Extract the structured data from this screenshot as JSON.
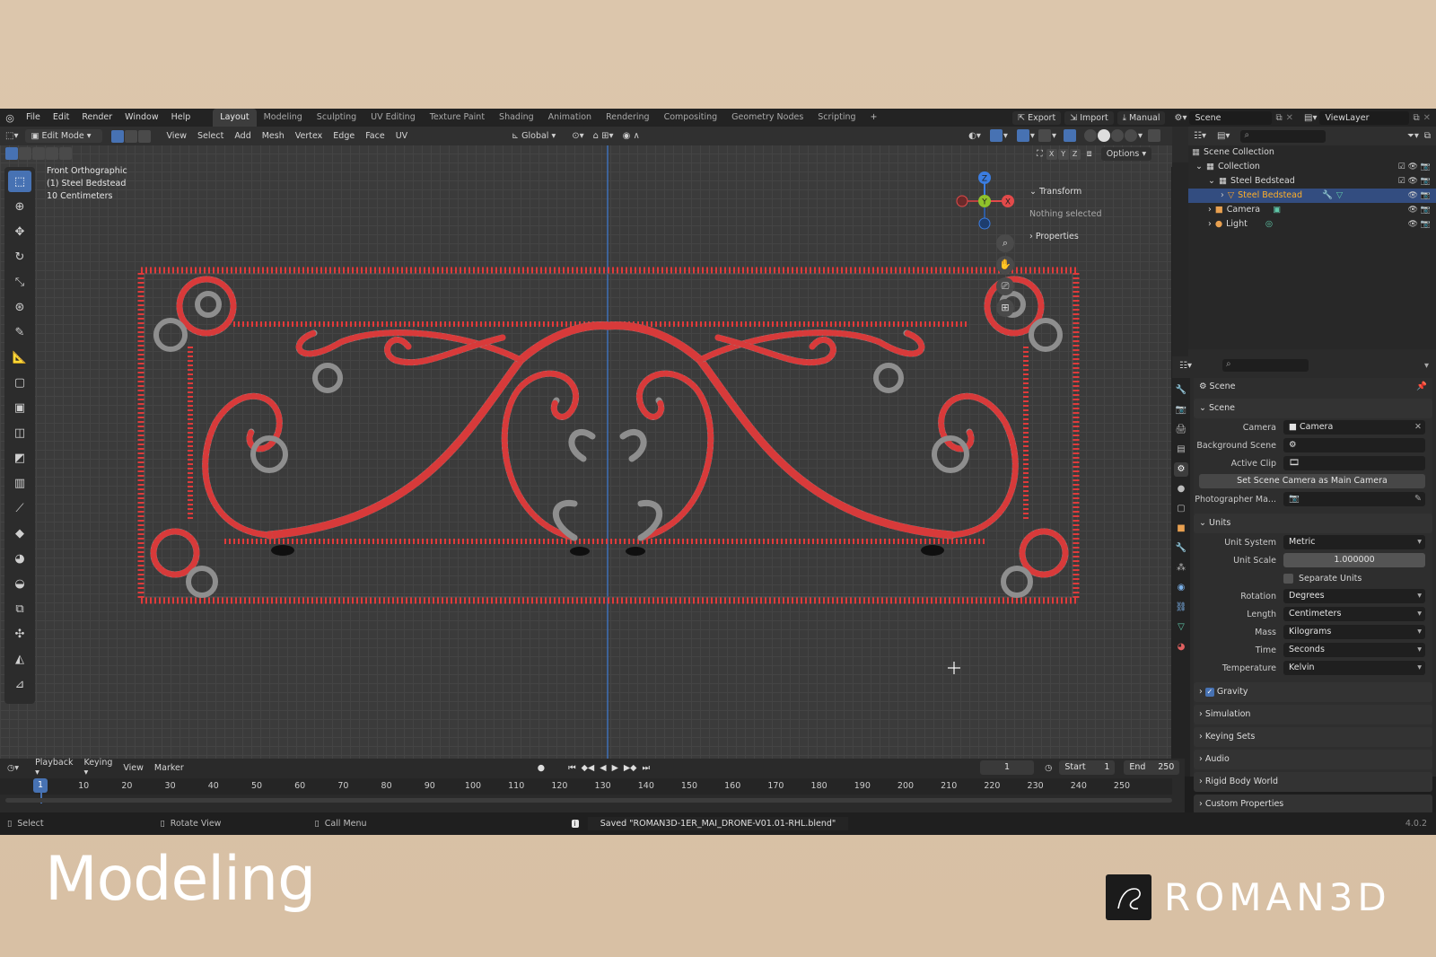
{
  "topbar": {
    "menus": [
      "File",
      "Edit",
      "Render",
      "Window",
      "Help"
    ],
    "workspaces": [
      "Layout",
      "Modeling",
      "Sculpting",
      "UV Editing",
      "Texture Paint",
      "Shading",
      "Animation",
      "Rendering",
      "Compositing",
      "Geometry Nodes",
      "Scripting"
    ],
    "active_workspace": "Layout",
    "export_label": "Export",
    "import_label": "Import",
    "manual_label": "Manual",
    "scene": "Scene",
    "view_layer": "ViewLayer"
  },
  "viewport": {
    "mode": "Edit Mode",
    "menus": [
      "View",
      "Select",
      "Add",
      "Mesh",
      "Vertex",
      "Edge",
      "Face",
      "UV"
    ],
    "orientation": "Global",
    "options_label": "Options",
    "axes": [
      "X",
      "Y",
      "Z"
    ],
    "info_view": "Front Orthographic",
    "info_object": "(1) Steel Bedstead",
    "info_scale": "10 Centimeters",
    "gizmo_axes": {
      "x": "X",
      "y": "Y",
      "z": "Z"
    },
    "axis_colors": {
      "x": "#e24a4a",
      "y": "#8fc22b",
      "z": "#3b7de1"
    },
    "edge_color": "#d83a3a",
    "vertex_color": "#9a9a9a",
    "transform_label": "Transform",
    "nothing_selected": "Nothing selected",
    "properties_label": "Properties"
  },
  "outliner": {
    "scene_collection": "Scene Collection",
    "collection": "Collection",
    "items": [
      {
        "name": "Steel Bedstead",
        "level": 2,
        "icon": "collection-icon"
      },
      {
        "name": "Steel Bedstead",
        "level": 3,
        "icon": "mesh-icon",
        "selected": true
      },
      {
        "name": "Camera",
        "level": 2,
        "icon": "camera-icon"
      },
      {
        "name": "Light",
        "level": 2,
        "icon": "light-icon"
      }
    ]
  },
  "properties": {
    "context": "Scene",
    "scene_section": "Scene",
    "camera_label": "Camera",
    "camera_value": "Camera",
    "background_scene_label": "Background Scene",
    "active_clip_label": "Active Clip",
    "set_camera_button": "Set Scene Camera as Main Camera",
    "photographer_label": "Photographer Ma...",
    "units_section": "Units",
    "unit_system_label": "Unit System",
    "unit_system_value": "Metric",
    "unit_scale_label": "Unit Scale",
    "unit_scale_value": "1.000000",
    "separate_units_label": "Separate Units",
    "rotation_label": "Rotation",
    "rotation_value": "Degrees",
    "length_label": "Length",
    "length_value": "Centimeters",
    "mass_label": "Mass",
    "mass_value": "Kilograms",
    "time_label": "Time",
    "time_value": "Seconds",
    "temperature_label": "Temperature",
    "temperature_value": "Kelvin",
    "collapsed": [
      "Gravity",
      "Simulation",
      "Keying Sets",
      "Audio",
      "Rigid Body World",
      "Custom Properties"
    ],
    "gravity_checked": true
  },
  "timeline": {
    "menus": [
      "Playback",
      "Keying",
      "View",
      "Marker"
    ],
    "current_frame": "1",
    "start_label": "Start",
    "start_value": "1",
    "end_label": "End",
    "end_value": "250",
    "ticks": [
      "10",
      "20",
      "30",
      "40",
      "50",
      "60",
      "70",
      "80",
      "90",
      "100",
      "110",
      "120",
      "130",
      "140",
      "150",
      "160",
      "170",
      "180",
      "190",
      "200",
      "210",
      "220",
      "230",
      "240",
      "250"
    ],
    "cursor_frame": "1"
  },
  "statusbar": {
    "select": "Select",
    "rotate": "Rotate View",
    "call_menu": "Call Menu",
    "saved_message": "Saved \"ROMAN3D-1ER_MAI_DRONE-V01.01-RHL.blend\"",
    "version": "4.0.2"
  },
  "overlay": {
    "title": "Modeling",
    "brand": "ROMAN3D"
  }
}
